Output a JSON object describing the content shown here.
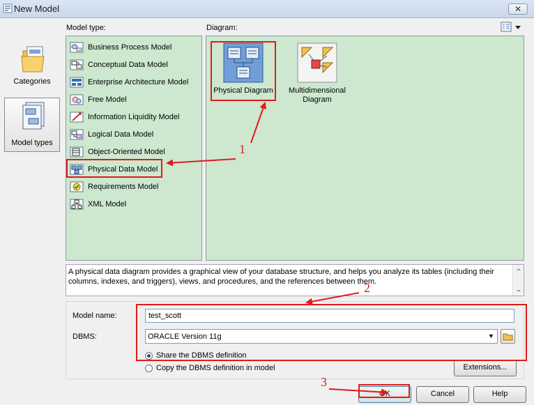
{
  "window": {
    "title": "New Model",
    "close_label": "✕"
  },
  "categories": [
    {
      "label": "Categories",
      "icon": "categories-folder-icon",
      "selected": false
    },
    {
      "label": "Model types",
      "icon": "model-types-icon",
      "selected": true
    }
  ],
  "model_type": {
    "label": "Model type:",
    "items": [
      {
        "label": "Business Process Model",
        "icon": "business-process-model-icon"
      },
      {
        "label": "Conceptual Data Model",
        "icon": "conceptual-data-model-icon"
      },
      {
        "label": "Enterprise Architecture Model",
        "icon": "enterprise-architecture-model-icon"
      },
      {
        "label": "Free Model",
        "icon": "free-model-icon"
      },
      {
        "label": "Information Liquidity Model",
        "icon": "information-liquidity-model-icon"
      },
      {
        "label": "Logical Data Model",
        "icon": "logical-data-model-icon"
      },
      {
        "label": "Object-Oriented Model",
        "icon": "object-oriented-model-icon"
      },
      {
        "label": "Physical Data Model",
        "icon": "physical-data-model-icon"
      },
      {
        "label": "Requirements Model",
        "icon": "requirements-model-icon"
      },
      {
        "label": "XML Model",
        "icon": "xml-model-icon"
      }
    ],
    "selected": "Physical Data Model"
  },
  "diagram": {
    "label": "Diagram:",
    "items": [
      {
        "label": "Physical Diagram",
        "icon": "physical-diagram-icon",
        "selected": true
      },
      {
        "label": "Multidimensional Diagram",
        "icon": "multidimensional-diagram-icon",
        "selected": false
      }
    ]
  },
  "description": "A physical data diagram provides a graphical view of your database structure, and helps you analyze its tables (including their columns, indexes, and triggers), views, and procedures, and the references between them.",
  "form": {
    "model_name_label": "Model name:",
    "model_name_value": "test_scott",
    "dbms_label": "DBMS:",
    "dbms_value": "ORACLE Version 11g",
    "share_label": "Share the DBMS definition",
    "copy_label": "Copy the DBMS definition in model",
    "share_selected": true,
    "extensions_label": "Extensions..."
  },
  "buttons": {
    "ok": "OK",
    "cancel": "Cancel",
    "help": "Help"
  },
  "annotations": {
    "step1": "1",
    "step2": "2",
    "step3": "3",
    "color": "#e01b1b"
  }
}
